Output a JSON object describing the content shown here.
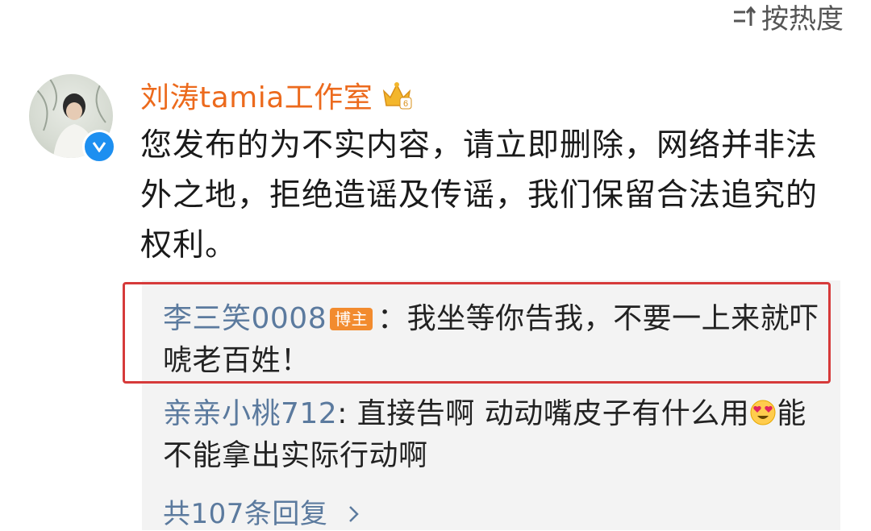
{
  "header": {
    "sort_label": "按热度"
  },
  "comment": {
    "username": "刘涛tamia工作室",
    "crown_level": "6",
    "text": "您发布的为不实内容，请立即删除，网络并非法外之地，拒绝造谣及传谣，我们保留合法追究的权利。"
  },
  "replies": [
    {
      "name": "李三笑0008",
      "badge": "博主",
      "separator": "：",
      "text": "我坐等你告我，不要一上来就吓唬老百姓！"
    },
    {
      "name": "亲亲小桃712",
      "separator": ": ",
      "text_before_emoji": "直接告啊 动动嘴皮子有什么用",
      "text_after_emoji": "能不能拿出实际行动啊"
    }
  ],
  "more_replies_label": "共107条回复",
  "colors": {
    "username": "#ec6a1d",
    "reply_name": "#5b7a9e",
    "highlight_border": "#d63a3a",
    "verified": "#1d8ff0",
    "blogger_badge": "#f28b2e"
  }
}
